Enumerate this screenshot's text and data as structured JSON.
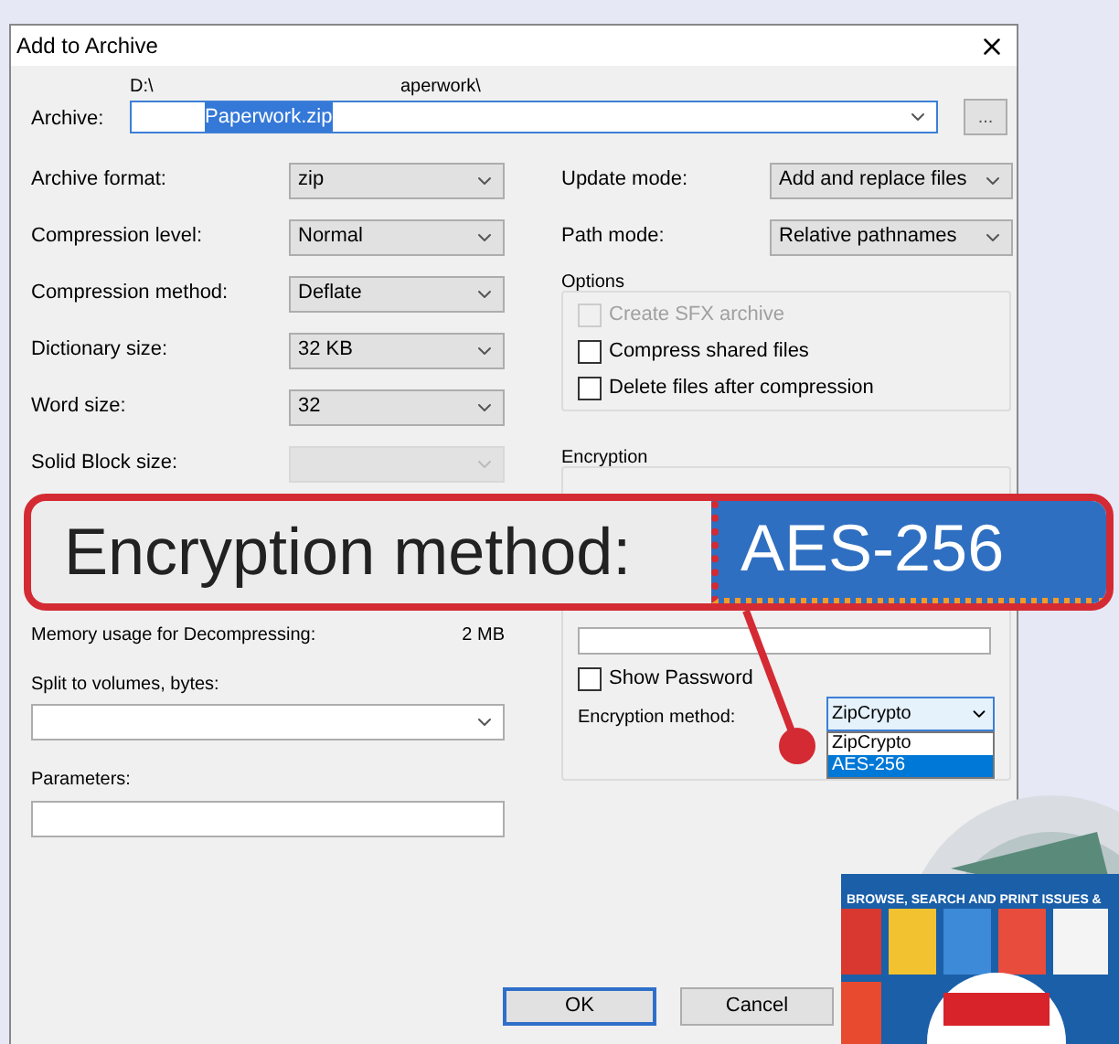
{
  "dialog": {
    "title": "Add to Archive"
  },
  "archive": {
    "label": "Archive:",
    "path": "D:\\",
    "path_2": "aperwork\\",
    "value": "Paperwork.zip",
    "browse": "..."
  },
  "left_fields": [
    {
      "label": "Archive format:",
      "value": "zip",
      "disabled": false
    },
    {
      "label": "Compression level:",
      "value": "Normal",
      "disabled": false
    },
    {
      "label": "Compression method:",
      "value": "Deflate",
      "disabled": false
    },
    {
      "label": "Dictionary size:",
      "value": "32 KB",
      "disabled": false
    },
    {
      "label": "Word size:",
      "value": "32",
      "disabled": false
    },
    {
      "label": "Solid Block size:",
      "disabled": true
    }
  ],
  "right_fields": [
    {
      "label": "Update mode:",
      "value": "Add and replace files"
    },
    {
      "label": "Path mode:",
      "value": "Relative pathnames"
    }
  ],
  "options": {
    "title": "Options",
    "checkboxes": [
      {
        "label": "Create SFX archive",
        "checked": false,
        "disabled": true
      },
      {
        "label": "Compress shared files",
        "checked": false,
        "disabled": false
      },
      {
        "label": "Delete files after compression",
        "checked": false,
        "disabled": false
      }
    ]
  },
  "memory": {
    "label": "Memory usage for Decompressing:",
    "value": "2 MB"
  },
  "split": {
    "label": "Split to volumes, bytes:"
  },
  "parameters": {
    "label": "Parameters:"
  },
  "encryption": {
    "title": "Encryption",
    "show_password": {
      "label": "Show Password",
      "checked": false
    },
    "method_label": "Encryption method:",
    "method_value": "ZipCrypto",
    "dropdown": [
      {
        "label": "ZipCrypto",
        "selected": false
      },
      {
        "label": "AES-256",
        "selected": true
      }
    ]
  },
  "callout": {
    "label": "Encryption method:",
    "value": "AES-256"
  },
  "buttons": [
    {
      "label": "OK",
      "default": true
    },
    {
      "label": "Cancel",
      "default": false
    }
  ],
  "promo": {
    "headline": "BROWSE, SEARCH AND PRINT ISSUES &"
  }
}
